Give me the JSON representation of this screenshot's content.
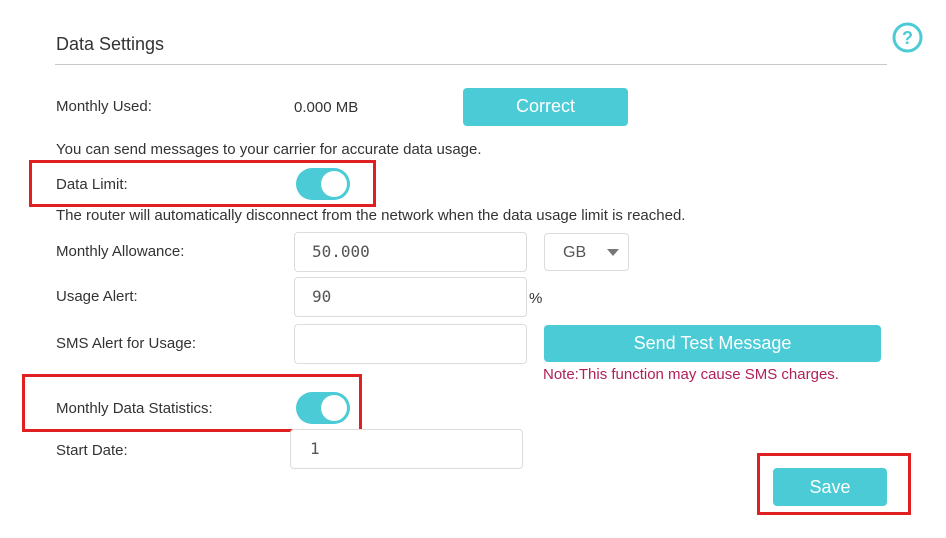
{
  "section": {
    "title": "Data Settings"
  },
  "monthly_used": {
    "label": "Monthly Used:",
    "value": "0.000 MB",
    "button": "Correct"
  },
  "carrier_info": "You can send messages to your carrier for accurate data usage.",
  "data_limit": {
    "label": "Data Limit:",
    "enabled": true
  },
  "disconnect_info": "The router will automatically disconnect from the network when the data usage limit is reached.",
  "monthly_allowance": {
    "label": "Monthly Allowance:",
    "value": "50.000",
    "unit": "GB"
  },
  "usage_alert": {
    "label": "Usage Alert:",
    "value": "90",
    "unit": "%"
  },
  "sms_alert": {
    "label": "SMS Alert for Usage:",
    "value": "",
    "button": "Send Test Message",
    "note": "Note:This function may cause SMS charges."
  },
  "monthly_stats": {
    "label": "Monthly Data Statistics:",
    "enabled": true
  },
  "start_date": {
    "label": "Start Date:",
    "value": "1"
  },
  "save_label": "Save",
  "colors": {
    "accent": "#4acbd6",
    "highlight": "#e02020",
    "note": "#b0205a"
  }
}
